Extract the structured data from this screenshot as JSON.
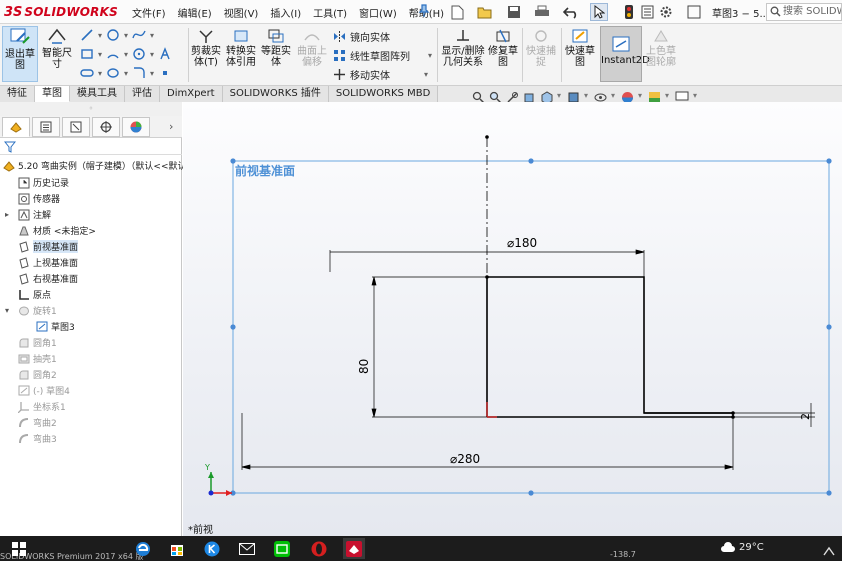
{
  "app": {
    "logo_prefix": "3S",
    "logo_name": "SOLIDWORKS"
  },
  "menu": {
    "items": [
      "文件(F)",
      "编辑(E)",
      "视图(V)",
      "插入(I)",
      "工具(T)",
      "窗口(W)",
      "帮助(H)"
    ]
  },
  "title": {
    "document": "草图3 − 5...",
    "search_placeholder": "搜索 SOLIDWO"
  },
  "ribbon": {
    "exit_sketch": "退出草图",
    "smart_dimension": "智能尺寸",
    "trim_entities": "剪裁实体(T)",
    "convert_entities": "转换实体引用",
    "offset_entities": "等距实体",
    "offset_on_surface": "曲面上偏移",
    "mirror_entities": "镜向实体",
    "linear_pattern": "线性草图阵列",
    "move_entities": "移动实体",
    "display_relations": "显示/删除几何关系",
    "repair_sketch": "修复草图",
    "quick_snaps": "快速捕捉",
    "rapid_sketch": "快速草图",
    "instant2d": "Instant2D",
    "shaded_contours": "上色草图轮廓"
  },
  "tabs": [
    "特征",
    "草图",
    "模具工具",
    "评估",
    "DimXpert",
    "SOLIDWORKS 插件",
    "SOLIDWORKS MBD"
  ],
  "active_tab": "草图",
  "tree": {
    "root": "5.20 弯曲实例（帽子建模）（默认<<默认",
    "items": [
      {
        "label": "历史记录",
        "icon": "history-icon"
      },
      {
        "label": "传感器",
        "icon": "sensor-icon"
      },
      {
        "label": "注解",
        "icon": "annotation-icon"
      },
      {
        "label": "材质 <未指定>",
        "icon": "material-icon"
      },
      {
        "label": "前视基准面",
        "icon": "plane-icon"
      },
      {
        "label": "上视基准面",
        "icon": "plane-icon"
      },
      {
        "label": "右视基准面",
        "icon": "plane-icon"
      },
      {
        "label": "原点",
        "icon": "origin-icon"
      },
      {
        "label": "旋转1",
        "icon": "revolve-icon"
      },
      {
        "label": "草图3",
        "icon": "sketch-icon"
      },
      {
        "label": "圆角1",
        "icon": "fillet-icon"
      },
      {
        "label": "抽壳1",
        "icon": "shell-icon"
      },
      {
        "label": "圆角2",
        "icon": "fillet-icon"
      },
      {
        "label": "(-) 草图4",
        "icon": "sketch-icon"
      },
      {
        "label": "坐标系1",
        "icon": "coordinate-icon"
      },
      {
        "label": "弯曲2",
        "icon": "flex-icon"
      },
      {
        "label": "弯曲3",
        "icon": "flex-icon"
      }
    ]
  },
  "graphics": {
    "plane_label": "前视基准面",
    "dim_top": "⌀180",
    "dim_bottom": "⌀280",
    "dim_height": "80",
    "dim_small": "2",
    "view_label": "*前视"
  },
  "taskbar": {
    "status_text": "SOLIDWORKS Premium 2017 x64 版",
    "coordinate": "-138.7",
    "temperature": "29°C"
  },
  "colors": {
    "sketch_line": "#000000",
    "plane_border": "#6aa8e0",
    "plane_label": "#4f91d6",
    "origin_red": "#e02020",
    "brand_red": "#d0021b"
  }
}
